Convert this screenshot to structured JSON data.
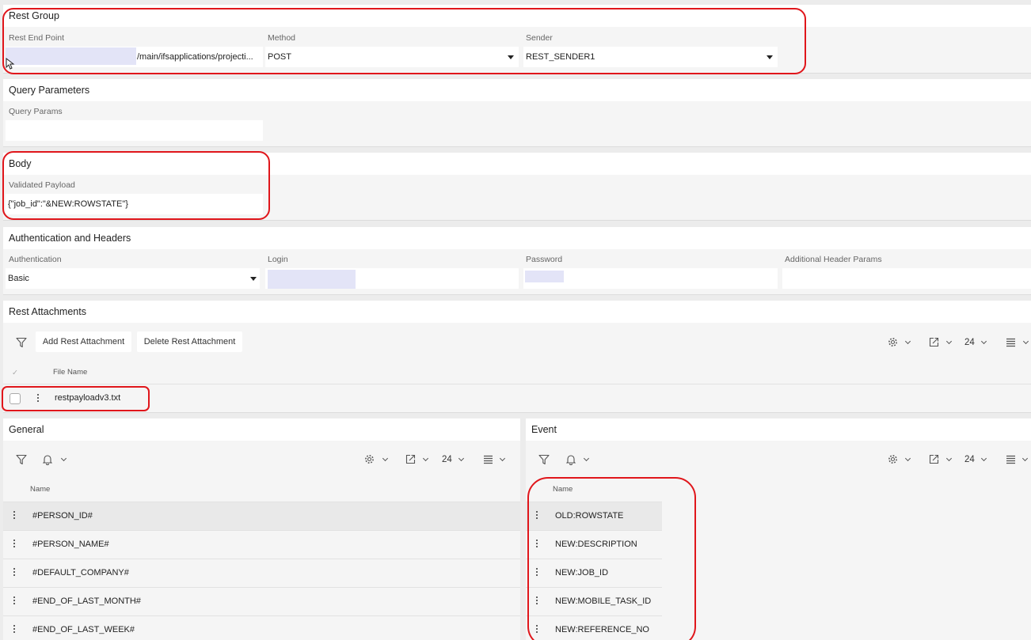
{
  "rest_group": {
    "title": "Rest Group",
    "endpoint_label": "Rest End Point",
    "endpoint_value": "/main/ifsapplications/projecti...",
    "method_label": "Method",
    "method_value": "POST",
    "sender_label": "Sender",
    "sender_value": "REST_SENDER1"
  },
  "query_parameters": {
    "title": "Query Parameters",
    "params_label": "Query Params",
    "params_value": ""
  },
  "body": {
    "title": "Body",
    "payload_label": "Validated Payload",
    "payload_value": "{\"job_id\":\"&NEW:ROWSTATE\"}"
  },
  "auth_headers": {
    "title": "Authentication and Headers",
    "authentication_label": "Authentication",
    "authentication_value": "Basic",
    "login_label": "Login",
    "password_label": "Password",
    "additional_label": "Additional Header Params"
  },
  "rest_attachments": {
    "title": "Rest Attachments",
    "add_label": "Add Rest Attachment",
    "delete_label": "Delete Rest Attachment",
    "page_size": "24",
    "check_header": "✓",
    "file_name_header": "File Name",
    "rows": [
      "restpayloadv3.txt"
    ]
  },
  "general": {
    "title": "General",
    "page_size": "24",
    "name_header": "Name",
    "rows": [
      "#PERSON_ID#",
      "#PERSON_NAME#",
      "#DEFAULT_COMPANY#",
      "#END_OF_LAST_MONTH#",
      "#END_OF_LAST_WEEK#"
    ]
  },
  "event": {
    "title": "Event",
    "page_size": "24",
    "name_header": "Name",
    "rows": [
      "OLD:ROWSTATE",
      "NEW:DESCRIPTION",
      "NEW:JOB_ID",
      "NEW:MOBILE_TASK_ID",
      "NEW:REFERENCE_NO"
    ]
  },
  "icons": {
    "filter": "filter-icon",
    "bell": "bell-icon",
    "gear": "gear-icon",
    "export": "export-icon",
    "density": "density-icon",
    "kebab": "kebab-icon"
  },
  "colors": {
    "annotation_red": "#e0161b",
    "redacted": "#e3e4f7"
  }
}
